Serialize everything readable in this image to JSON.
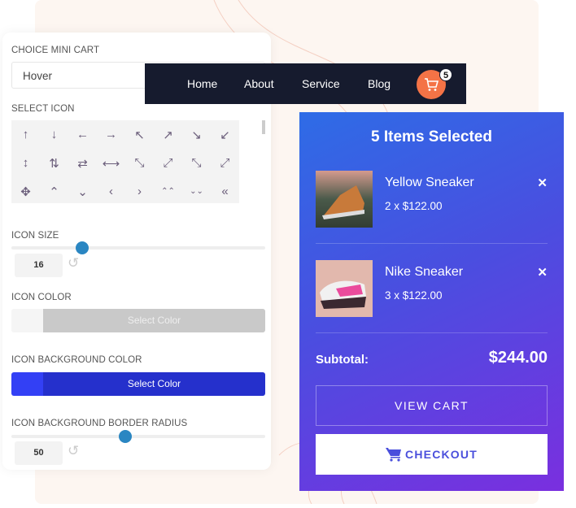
{
  "panel": {
    "choice_label": "CHOICE MINI CART",
    "choice_value": "Hover",
    "select_icon_label": "SELECT ICON",
    "icons": [
      "↑",
      "↓",
      "←",
      "→",
      "↖",
      "↗",
      "↘",
      "↙",
      "↕",
      "⇅",
      "⇄",
      "⟷",
      "⤡",
      "⤢",
      "⤡",
      "⤢",
      "✥",
      "⌃",
      "⌄",
      "‹",
      "›",
      "⌃⌃",
      "⌄⌄",
      "«"
    ],
    "icon_size_label": "ICON SIZE",
    "icon_size_value": "16",
    "icon_size_fraction": 0.28,
    "icon_color_label": "ICON COLOR",
    "icon_color_button": "Select Color",
    "icon_color_swatch": "#f5f5f5",
    "icon_bg_label": "ICON BACKGROUND COLOR",
    "icon_bg_button": "Select Color",
    "icon_bg_swatch": "#3340f5",
    "radius_label": "ICON BACKGROUND BORDER RADIUS",
    "radius_value": "50",
    "radius_fraction": 0.45
  },
  "nav": {
    "items": [
      "Home",
      "About",
      "Service",
      "Blog"
    ],
    "cart_count": "5",
    "cart_color": "#f47346"
  },
  "cart": {
    "title": "5 Items Selected",
    "items": [
      {
        "name": "Yellow Sneaker",
        "price": "2 x $122.00"
      },
      {
        "name": "Nike Sneaker",
        "price": "3 x $122.00"
      }
    ],
    "subtotal_label": "Subtotal:",
    "subtotal_value": "$244.00",
    "view_cart": "VIEW CART",
    "checkout": "CHECKOUT"
  }
}
